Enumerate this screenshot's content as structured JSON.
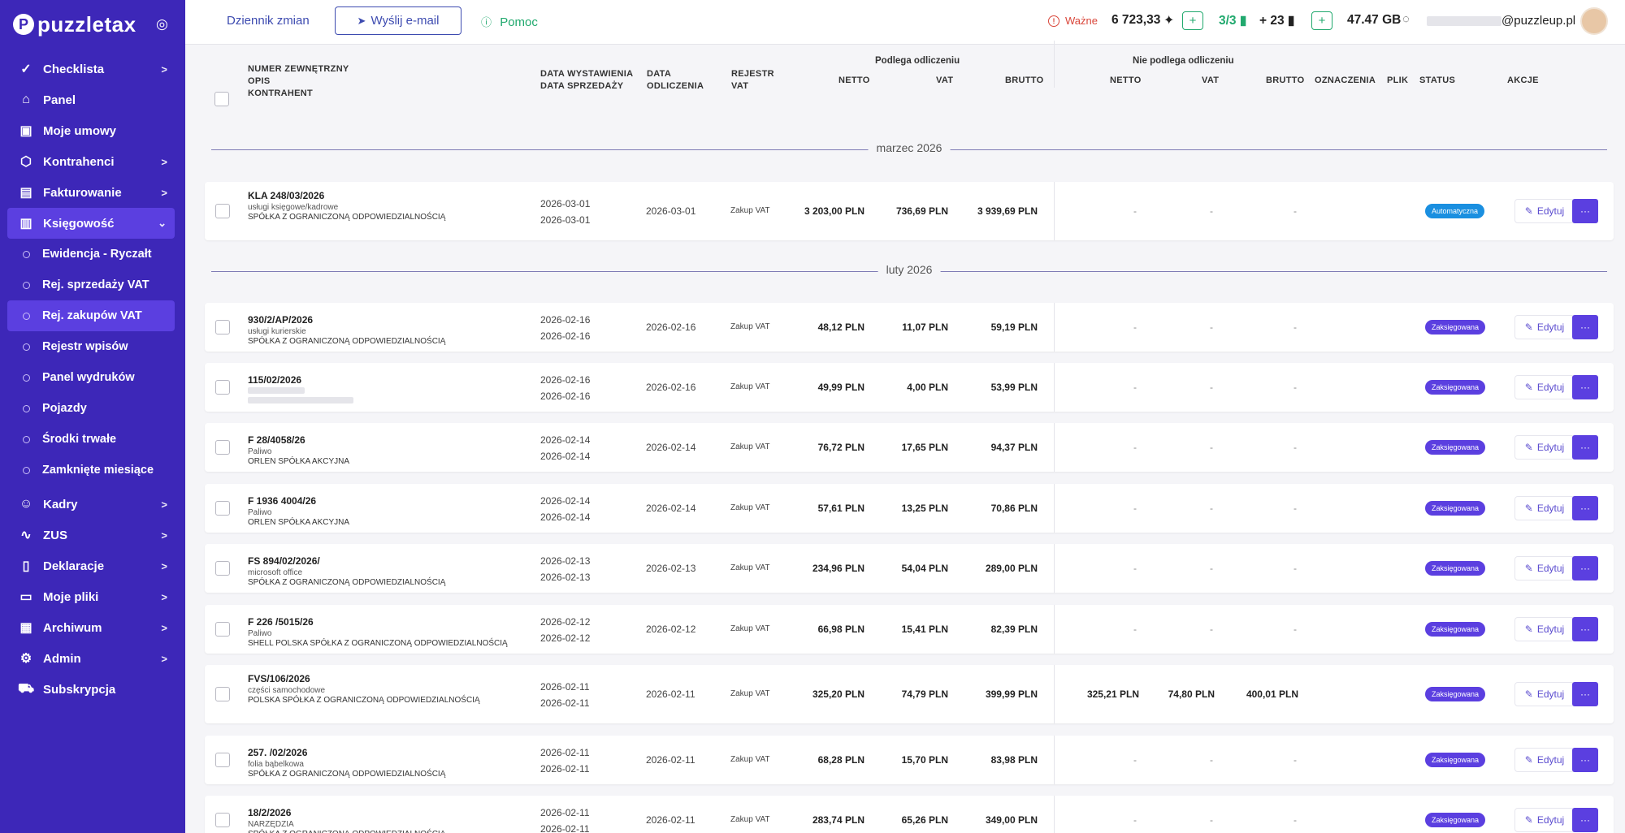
{
  "logo": {
    "text": "puzzletax"
  },
  "sidebar": {
    "items": [
      {
        "label": "Checklista",
        "icon": "checklist-icon",
        "chevron": ">"
      },
      {
        "label": "Panel",
        "icon": "home-icon",
        "chevron": ""
      },
      {
        "label": "Moje umowy",
        "icon": "briefcase-icon",
        "chevron": ""
      },
      {
        "label": "Kontrahenci",
        "icon": "box-icon",
        "chevron": ">"
      },
      {
        "label": "Fakturowanie",
        "icon": "document-icon",
        "chevron": ">"
      },
      {
        "label": "Księgowość",
        "icon": "ledger-icon",
        "chevron": "⌄"
      }
    ],
    "sub_items": [
      {
        "label": "Ewidencja - Ryczałt"
      },
      {
        "label": "Rej. sprzedaży VAT"
      },
      {
        "label": "Rej. zakupów VAT"
      },
      {
        "label": "Rejestr wpisów"
      },
      {
        "label": "Panel wydruków"
      },
      {
        "label": "Pojazdy"
      },
      {
        "label": "Środki trwałe"
      },
      {
        "label": "Zamknięte miesiące"
      }
    ],
    "items2": [
      {
        "label": "Kadry",
        "icon": "people-icon",
        "chevron": ">"
      },
      {
        "label": "ZUS",
        "icon": "pulse-icon",
        "chevron": ">"
      },
      {
        "label": "Deklaracje",
        "icon": "book-icon",
        "chevron": ">"
      },
      {
        "label": "Moje pliki",
        "icon": "folder-icon",
        "chevron": ">"
      },
      {
        "label": "Archiwum",
        "icon": "archive-icon",
        "chevron": ">"
      },
      {
        "label": "Admin",
        "icon": "gear-icon",
        "chevron": ">"
      },
      {
        "label": "Subskrypcja",
        "icon": "cart-icon",
        "chevron": ""
      }
    ]
  },
  "topbar": {
    "changelog": "Dziennik zmian",
    "send_email": "Wyślij e-mail",
    "help": "Pomoc",
    "important": "Ważne",
    "credits": "6 723,33",
    "docs_ratio": "3/3",
    "docs_plus": "+ 23",
    "storage": "47.47 GB",
    "email_domain": "@puzzleup.pl"
  },
  "table": {
    "group_deductible": "Podlega odliczeniu",
    "group_nondeductible": "Nie podlega odliczeniu",
    "headers": {
      "numer": "NUMER ZEWNĘTRZNY",
      "opis": "OPIS",
      "kontrahent": "KONTRAHENT",
      "data_wyst": "DATA WYSTAWIENIA",
      "data_sprz": "DATA SPRZEDAŻY",
      "data_odl1": "DATA",
      "data_odl2": "ODLICZENIA",
      "rejestr1": "REJESTR",
      "rejestr2": "VAT",
      "netto": "NETTO",
      "vat": "VAT",
      "brutto": "BRUTTO",
      "netto2": "NETTO",
      "vat2": "VAT",
      "brutto2": "BRUTTO",
      "oznaczenia": "OZNACZENIA",
      "plik": "PLIK",
      "status": "STATUS",
      "akcje": "AKCJE"
    },
    "edit_label": "Edytuj",
    "more_label": "···",
    "months": [
      {
        "label": "marzec 2026"
      },
      {
        "label": "luty 2026"
      }
    ],
    "rows": [
      {
        "numer": "KLA 248/03/2026",
        "opis": "usługi księgowe/kadrowe",
        "kontrahent": "SPÓŁKA Z OGRANICZONĄ ODPOWIEDZIALNOŚCIĄ",
        "data_wyst": "2026-03-01",
        "data_sprz": "2026-03-01",
        "data_odl": "2026-03-01",
        "rejestr": "Zakup VAT",
        "netto": "3 203,00 PLN",
        "vat": "736,69 PLN",
        "brutto": "3 939,69 PLN",
        "netto2": "-",
        "vat2": "-",
        "brutto2": "-",
        "status": "Automatyczna",
        "status_color": "#1a8fe0"
      },
      {
        "numer": "930/2/AP/2026",
        "opis": "usługi kurierskie",
        "kontrahent": "SPÓŁKA Z OGRANICZONĄ ODPOWIEDZIALNOŚCIĄ",
        "data_wyst": "2026-02-16",
        "data_sprz": "2026-02-16",
        "data_odl": "2026-02-16",
        "rejestr": "Zakup VAT",
        "netto": "48,12 PLN",
        "vat": "11,07 PLN",
        "brutto": "59,19 PLN",
        "netto2": "-",
        "vat2": "-",
        "brutto2": "-",
        "status": "Zaksięgowana",
        "status_color": "#5b3fe0"
      },
      {
        "numer": "115/02/2026",
        "opis": "",
        "kontrahent": "",
        "data_wyst": "2026-02-16",
        "data_sprz": "2026-02-16",
        "data_odl": "2026-02-16",
        "rejestr": "Zakup VAT",
        "netto": "49,99 PLN",
        "vat": "4,00 PLN",
        "brutto": "53,99 PLN",
        "netto2": "-",
        "vat2": "-",
        "brutto2": "-",
        "status": "Zaksięgowana",
        "status_color": "#5b3fe0"
      },
      {
        "numer": "F 28/4058/26",
        "opis": "Paliwo",
        "kontrahent": "ORLEN SPÓŁKA AKCYJNA",
        "data_wyst": "2026-02-14",
        "data_sprz": "2026-02-14",
        "data_odl": "2026-02-14",
        "rejestr": "Zakup VAT",
        "netto": "76,72 PLN",
        "vat": "17,65 PLN",
        "brutto": "94,37 PLN",
        "netto2": "-",
        "vat2": "-",
        "brutto2": "-",
        "status": "Zaksięgowana",
        "status_color": "#5b3fe0"
      },
      {
        "numer": "F 1936 4004/26",
        "opis": "Paliwo",
        "kontrahent": "ORLEN SPÓŁKA AKCYJNA",
        "data_wyst": "2026-02-14",
        "data_sprz": "2026-02-14",
        "data_odl": "2026-02-14",
        "rejestr": "Zakup VAT",
        "netto": "57,61 PLN",
        "vat": "13,25 PLN",
        "brutto": "70,86 PLN",
        "netto2": "-",
        "vat2": "-",
        "brutto2": "-",
        "status": "Zaksięgowana",
        "status_color": "#5b3fe0"
      },
      {
        "numer": "FS 894/02/2026/",
        "opis": "microsoft office",
        "kontrahent": "SPÓŁKA Z OGRANICZONĄ ODPOWIEDZIALNOŚCIĄ",
        "data_wyst": "2026-02-13",
        "data_sprz": "2026-02-13",
        "data_odl": "2026-02-13",
        "rejestr": "Zakup VAT",
        "netto": "234,96 PLN",
        "vat": "54,04 PLN",
        "brutto": "289,00 PLN",
        "netto2": "-",
        "vat2": "-",
        "brutto2": "-",
        "status": "Zaksięgowana",
        "status_color": "#5b3fe0"
      },
      {
        "numer": "F 226 /5015/26",
        "opis": "Paliwo",
        "kontrahent": "SHELL POLSKA SPÓŁKA Z OGRANICZONĄ ODPOWIEDZIALNOŚCIĄ",
        "data_wyst": "2026-02-12",
        "data_sprz": "2026-02-12",
        "data_odl": "2026-02-12",
        "rejestr": "Zakup VAT",
        "netto": "66,98 PLN",
        "vat": "15,41 PLN",
        "brutto": "82,39 PLN",
        "netto2": "-",
        "vat2": "-",
        "brutto2": "-",
        "status": "Zaksięgowana",
        "status_color": "#5b3fe0"
      },
      {
        "numer": "FVS/106/2026",
        "opis": "części samochodowe",
        "kontrahent": "POLSKA SPÓŁKA Z OGRANICZONĄ ODPOWIEDZIALNOŚCIĄ",
        "data_wyst": "2026-02-11",
        "data_sprz": "2026-02-11",
        "data_odl": "2026-02-11",
        "rejestr": "Zakup VAT",
        "netto": "325,20 PLN",
        "vat": "74,79 PLN",
        "brutto": "399,99 PLN",
        "netto2": "325,21 PLN",
        "vat2": "74,80 PLN",
        "brutto2": "400,01 PLN",
        "status": "Zaksięgowana",
        "status_color": "#5b3fe0"
      },
      {
        "numer": "257. /02/2026",
        "opis": "folia bąbelkowa",
        "kontrahent": "SPÓŁKA Z OGRANICZONĄ ODPOWIEDZIALNOŚCIĄ",
        "data_wyst": "2026-02-11",
        "data_sprz": "2026-02-11",
        "data_odl": "2026-02-11",
        "rejestr": "Zakup VAT",
        "netto": "68,28 PLN",
        "vat": "15,70 PLN",
        "brutto": "83,98 PLN",
        "netto2": "-",
        "vat2": "-",
        "brutto2": "-",
        "status": "Zaksięgowana",
        "status_color": "#5b3fe0"
      },
      {
        "numer": "18/2/2026",
        "opis": "NARZĘDZIA",
        "kontrahent": "SPÓŁKA Z OGRANICZONĄ ODPOWIEDZIALNOŚCIĄ",
        "data_wyst": "2026-02-11",
        "data_sprz": "2026-02-11",
        "data_odl": "2026-02-11",
        "rejestr": "Zakup VAT",
        "netto": "283,74 PLN",
        "vat": "65,26 PLN",
        "brutto": "349,00 PLN",
        "netto2": "-",
        "vat2": "-",
        "brutto2": "-",
        "status": "Zaksięgowana",
        "status_color": "#5b3fe0"
      }
    ]
  }
}
